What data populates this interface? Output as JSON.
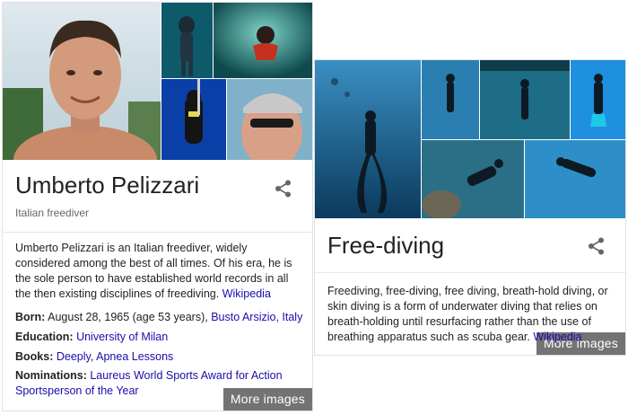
{
  "left_card": {
    "title": "Umberto Pelizzari",
    "subtitle": "Italian freediver",
    "more_images": "More images",
    "description": "Umberto Pelizzari is an Italian freediver, widely considered among the best of all times. Of his era, he is the sole person to have established world records in all the then existing disciplines of freediving.",
    "source_link": "Wikipedia",
    "facts": {
      "born": {
        "label": "Born:",
        "value": "August 28, 1965 (age 53 years),",
        "link": "Busto Arsizio, Italy"
      },
      "education": {
        "label": "Education:",
        "link": "University of Milan"
      },
      "books": {
        "label": "Books:",
        "link1": "Deeply",
        "separator": ",",
        "link2": "Apnea Lessons"
      },
      "nominations": {
        "label": "Nominations:",
        "link": "Laureus World Sports Award for Action Sportsperson of the Year"
      }
    }
  },
  "right_card": {
    "title": "Free-diving",
    "more_images": "More images",
    "description": "Freediving, free-diving, free diving, breath-hold diving, or skin diving is a form of underwater diving that relies on breath-holding until resurfacing rather than the use of breathing apparatus such as scuba gear.",
    "source_link": "Wikipedia"
  },
  "colors": {
    "link": "#1a0dab",
    "text": "#222222",
    "secondary": "#666666",
    "border": "#dfe1e5",
    "ocean_dark": "#0b3a5c",
    "ocean_light": "#2f86b8"
  },
  "icons": [
    "share-icon"
  ]
}
